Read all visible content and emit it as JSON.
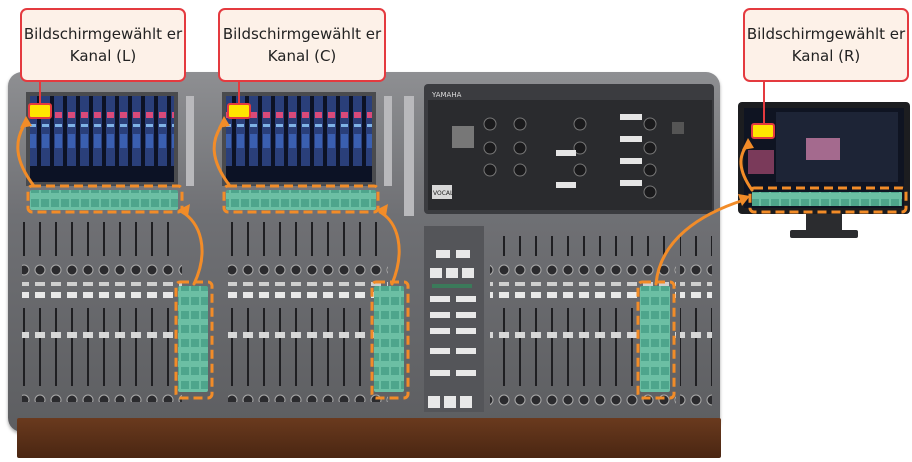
{
  "callouts": {
    "left": "Bildschirmgewählt er Kanal (L)",
    "center": "Bildschirmgewählt er Kanal (C)",
    "right": "Bildschirmgewählt er Kanal (R)"
  },
  "console": {
    "brand_text": "YAMAHA",
    "panel_label": "VOCAL"
  },
  "colors": {
    "highlight_yellow": "#ffe500",
    "highlight_red": "#e43a3f",
    "arrow_orange": "#f28c28",
    "channel_strip_green": "#4ea58c",
    "screen_dark": "#0c1225",
    "wood": "#5a2f17"
  }
}
